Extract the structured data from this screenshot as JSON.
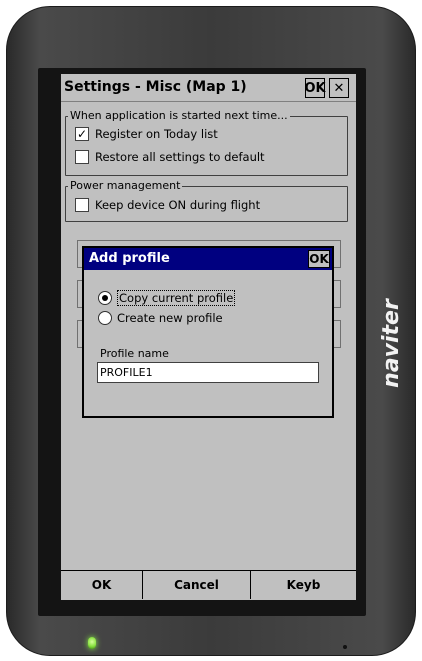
{
  "device": {
    "brand": "naviter",
    "icons": {
      "power_led": "led-indicator",
      "microphone": "mic-hole"
    }
  },
  "window": {
    "title": "Settings - Misc (Map 1)",
    "ok_label": "OK",
    "close_label": "✕"
  },
  "startup_group": {
    "legend": "When application is started next time...",
    "items": [
      {
        "label": "Register on Today list",
        "checked": true
      },
      {
        "label": "Restore all settings to default",
        "checked": false
      }
    ]
  },
  "power_group": {
    "legend": "Power management",
    "items": [
      {
        "label": "Keep device ON during flight",
        "checked": false
      }
    ]
  },
  "dialog": {
    "title": "Add profile",
    "ok_label": "OK",
    "options": [
      {
        "label": "Copy current profile",
        "selected": true
      },
      {
        "label": "Create new profile",
        "selected": false
      }
    ],
    "profile_name_label": "Profile name",
    "profile_name_value": "PROFILE1"
  },
  "bottom_bar": {
    "ok": "OK",
    "cancel": "Cancel",
    "keyboard": "Keyb"
  },
  "colors": {
    "dialog_title_bg": "#000080",
    "window_bg": "#c0c0c0",
    "led": "#88e040"
  }
}
